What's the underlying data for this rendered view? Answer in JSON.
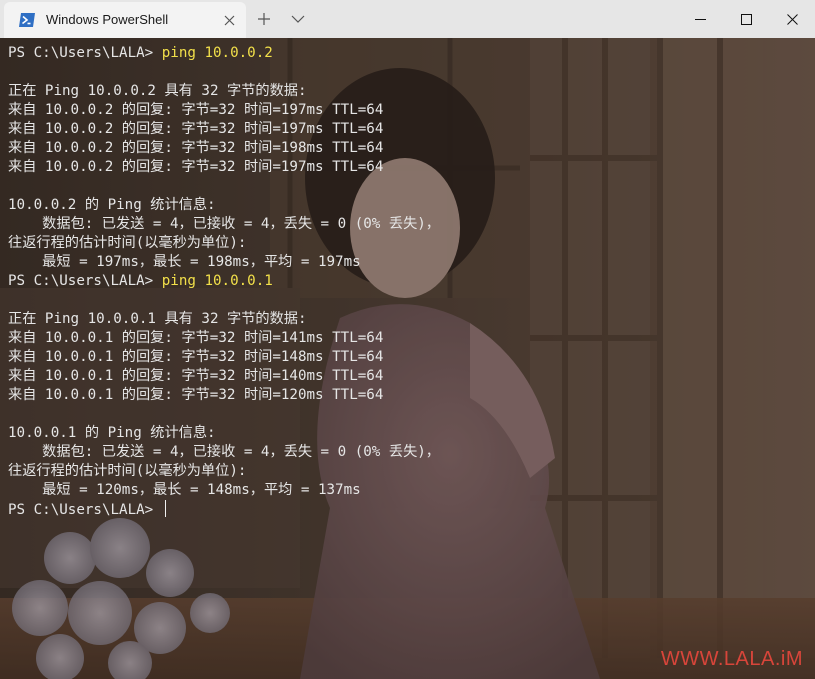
{
  "window": {
    "tab_title": "Windows PowerShell"
  },
  "terminal": {
    "lines": [
      {
        "prompt": "PS C:\\Users\\LALA> ",
        "command": "ping 10.0.0.2"
      },
      {
        "text": ""
      },
      {
        "text": "正在 Ping 10.0.0.2 具有 32 字节的数据:"
      },
      {
        "text": "来自 10.0.0.2 的回复: 字节=32 时间=197ms TTL=64"
      },
      {
        "text": "来自 10.0.0.2 的回复: 字节=32 时间=197ms TTL=64"
      },
      {
        "text": "来自 10.0.0.2 的回复: 字节=32 时间=198ms TTL=64"
      },
      {
        "text": "来自 10.0.0.2 的回复: 字节=32 时间=197ms TTL=64"
      },
      {
        "text": ""
      },
      {
        "text": "10.0.0.2 的 Ping 统计信息:"
      },
      {
        "text": "    数据包: 已发送 = 4，已接收 = 4，丢失 = 0 (0% 丢失)，"
      },
      {
        "text": "往返行程的估计时间(以毫秒为单位):"
      },
      {
        "text": "    最短 = 197ms，最长 = 198ms，平均 = 197ms"
      },
      {
        "prompt": "PS C:\\Users\\LALA> ",
        "command": "ping 10.0.0.1"
      },
      {
        "text": ""
      },
      {
        "text": "正在 Ping 10.0.0.1 具有 32 字节的数据:"
      },
      {
        "text": "来自 10.0.0.1 的回复: 字节=32 时间=141ms TTL=64"
      },
      {
        "text": "来自 10.0.0.1 的回复: 字节=32 时间=148ms TTL=64"
      },
      {
        "text": "来自 10.0.0.1 的回复: 字节=32 时间=140ms TTL=64"
      },
      {
        "text": "来自 10.0.0.1 的回复: 字节=32 时间=120ms TTL=64"
      },
      {
        "text": ""
      },
      {
        "text": "10.0.0.1 的 Ping 统计信息:"
      },
      {
        "text": "    数据包: 已发送 = 4，已接收 = 4，丢失 = 0 (0% 丢失)，"
      },
      {
        "text": "往返行程的估计时间(以毫秒为单位):"
      },
      {
        "text": "    最短 = 120ms，最长 = 148ms，平均 = 137ms"
      },
      {
        "prompt": "PS C:\\Users\\LALA> ",
        "command": "",
        "cursor": true
      }
    ]
  },
  "watermark": "WWW.LALA.iM",
  "colors": {
    "command": "#f2e04a",
    "output": "#e6e6e6",
    "watermark": "#d8453a",
    "titlebar": "#e6e6e6",
    "tab": "#f3f3f3"
  }
}
